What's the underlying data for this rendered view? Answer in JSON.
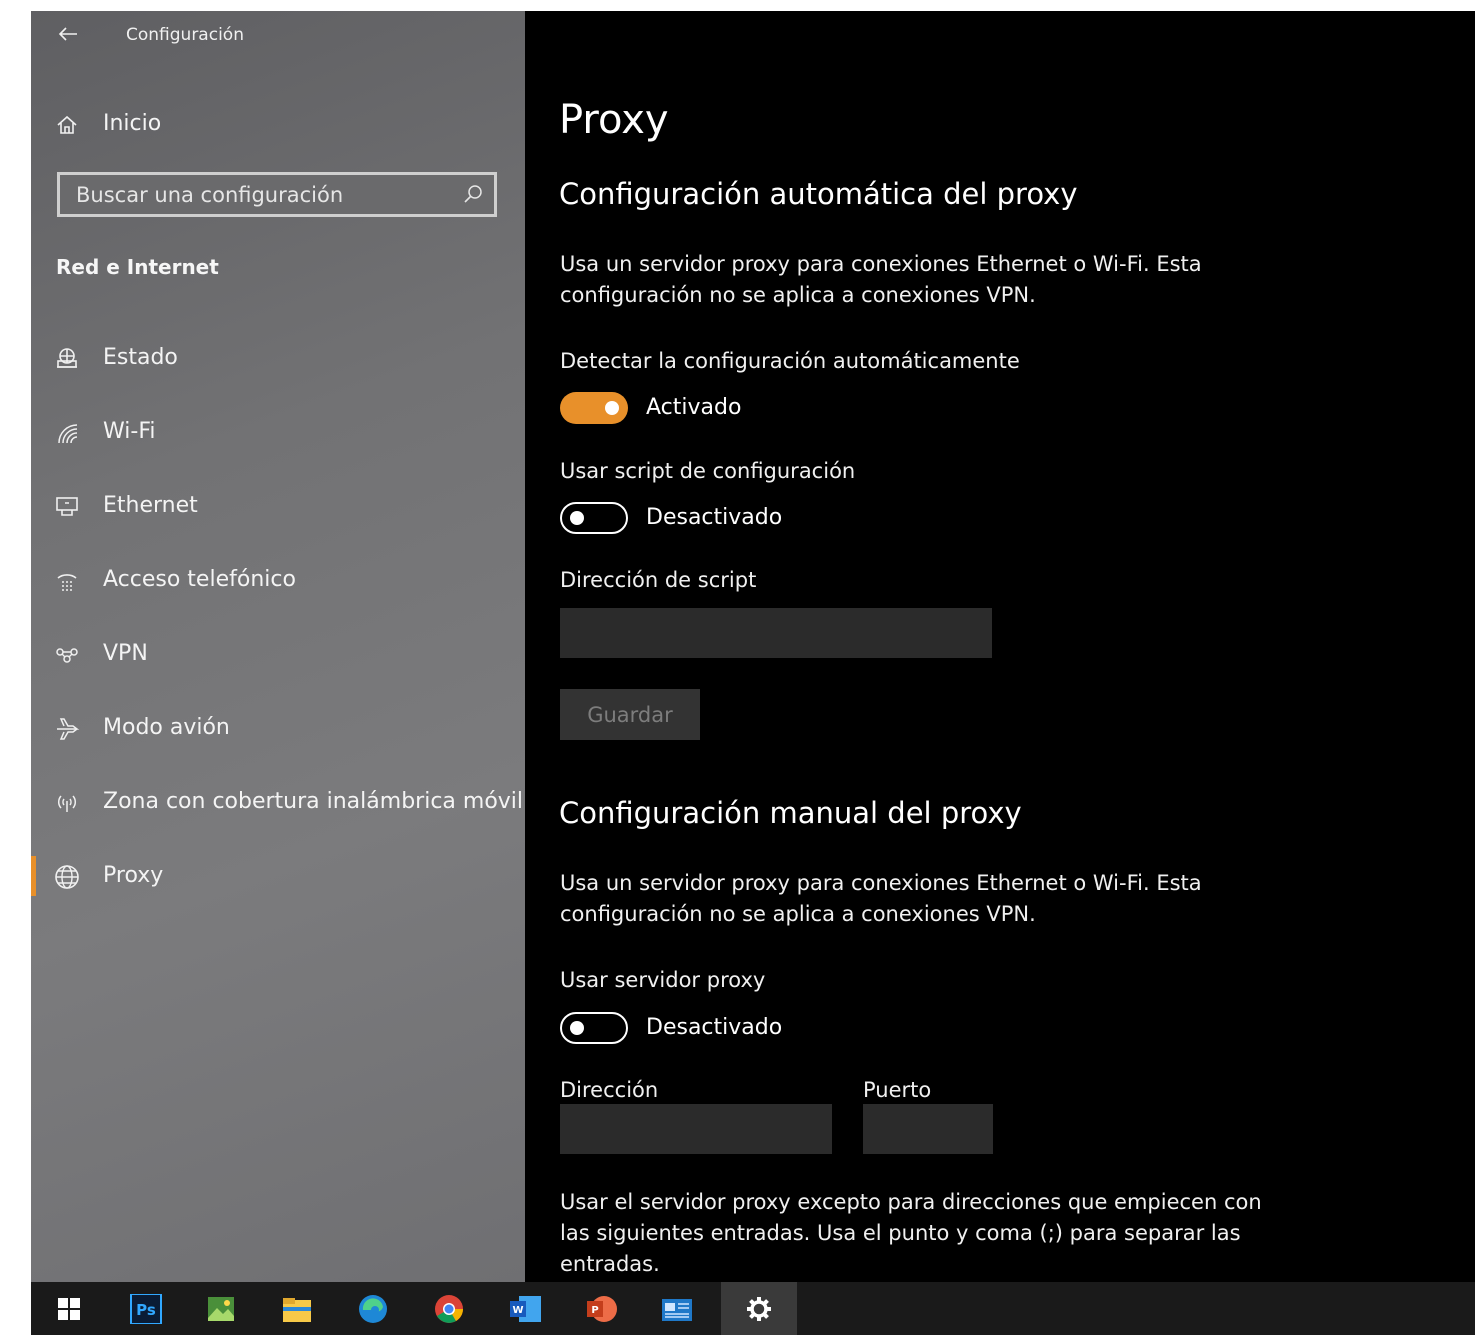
{
  "window": {
    "title": "Configuración"
  },
  "sidebar": {
    "home_label": "Inicio",
    "search_placeholder": "Buscar una configuración",
    "section_title": "Red e Internet",
    "items": [
      {
        "label": "Estado",
        "icon": "status-icon"
      },
      {
        "label": "Wi-Fi",
        "icon": "wifi-icon"
      },
      {
        "label": "Ethernet",
        "icon": "ethernet-icon"
      },
      {
        "label": "Acceso telefónico",
        "icon": "dialup-icon"
      },
      {
        "label": "VPN",
        "icon": "vpn-icon"
      },
      {
        "label": "Modo avión",
        "icon": "airplane-icon"
      },
      {
        "label": "Zona con cobertura inalámbrica móvil",
        "icon": "hotspot-icon"
      },
      {
        "label": "Proxy",
        "icon": "globe-icon",
        "active": true
      }
    ]
  },
  "main": {
    "title": "Proxy",
    "auto": {
      "heading": "Configuración automática del proxy",
      "desc_line1": "Usa un servidor proxy para conexiones Ethernet o Wi-Fi. Esta",
      "desc_line2": "configuración no se aplica a conexiones VPN.",
      "detect_label": "Detectar la configuración automáticamente",
      "detect_state": "Activado",
      "script_label": "Usar script de configuración",
      "script_state": "Desactivado",
      "script_address_label": "Dirección de script",
      "script_address_value": "",
      "save_label": "Guardar"
    },
    "manual": {
      "heading": "Configuración manual del proxy",
      "desc_line1": "Usa un servidor proxy para conexiones Ethernet o Wi-Fi. Esta",
      "desc_line2": "configuración no se aplica a conexiones VPN.",
      "use_proxy_label": "Usar servidor proxy",
      "use_proxy_state": "Desactivado",
      "address_label": "Dirección",
      "address_value": "",
      "port_label": "Puerto",
      "port_value": "",
      "exceptions_line1": "Usar el servidor proxy excepto para direcciones que empiecen con",
      "exceptions_line2": "las siguientes entradas. Usa el punto y coma (;) para separar las",
      "exceptions_line3": "entradas."
    }
  },
  "colors": {
    "accent": "#e8902a",
    "main_bg": "#000000",
    "input_bg": "#2b2b2b"
  },
  "taskbar": {
    "items": [
      "windows-start-icon",
      "photoshop-icon",
      "photo-app-icon",
      "file-explorer-icon",
      "edge-icon",
      "chrome-icon",
      "word-icon",
      "powerpoint-icon",
      "news-icon",
      "settings-icon"
    ],
    "ps_text": "Ps",
    "w_text": "W",
    "p_text": "P"
  }
}
